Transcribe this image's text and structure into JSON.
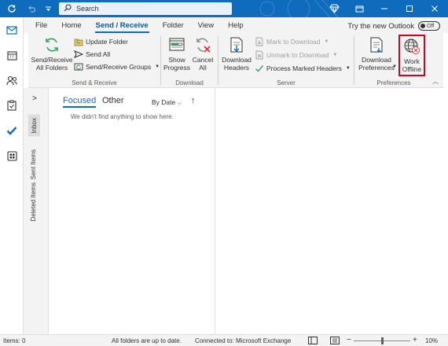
{
  "titlebar": {
    "search_placeholder": "Search",
    "icons": [
      "sync-icon",
      "undo-icon",
      "customize-icon",
      "search-icon",
      "diamond-icon",
      "restore-icon",
      "minimize-icon",
      "maximize-icon",
      "close-icon"
    ]
  },
  "tabs": [
    {
      "label": "File"
    },
    {
      "label": "Home"
    },
    {
      "label": "Send / Receive",
      "active": true
    },
    {
      "label": "Folder"
    },
    {
      "label": "View"
    },
    {
      "label": "Help"
    }
  ],
  "new_outlook": {
    "label": "Try the new Outlook",
    "toggle": "Off"
  },
  "ribbon": {
    "send_receive_group": {
      "label": "Send & Receive",
      "send_receive_all": "Send/Receive\nAll Folders",
      "update_folder": "Update Folder",
      "send_all": "Send All",
      "send_receive_groups": "Send/Receive Groups"
    },
    "download_group": {
      "label": "Download",
      "show_progress": "Show\nProgress",
      "cancel_all": "Cancel\nAll"
    },
    "server_group": {
      "label": "Server",
      "download_headers": "Download\nHeaders",
      "mark_to_download": "Mark to Download",
      "unmark_to_download": "Unmark to Download",
      "process_marked_headers": "Process Marked Headers"
    },
    "preferences_group": {
      "label": "Preferences",
      "download_preferences": "Download\nPreferences",
      "work_offline": "Work\nOffline"
    }
  },
  "folder_pane": {
    "items": [
      "Inbox",
      "Sent Items",
      "Deleted Items"
    ]
  },
  "message_list": {
    "tab_focused": "Focused",
    "tab_other": "Other",
    "sort_label": "By Date",
    "empty_text": "We didn't find anything to show here."
  },
  "statusbar": {
    "items": "Items: 0",
    "folders_status": "All folders are up to date.",
    "connection": "Connected to: Microsoft Exchange",
    "zoom": "10%",
    "zoom_minus": "−",
    "zoom_plus": "+"
  },
  "colors": {
    "accent": "#0f6cbd",
    "highlight_box": "#d0021b"
  }
}
